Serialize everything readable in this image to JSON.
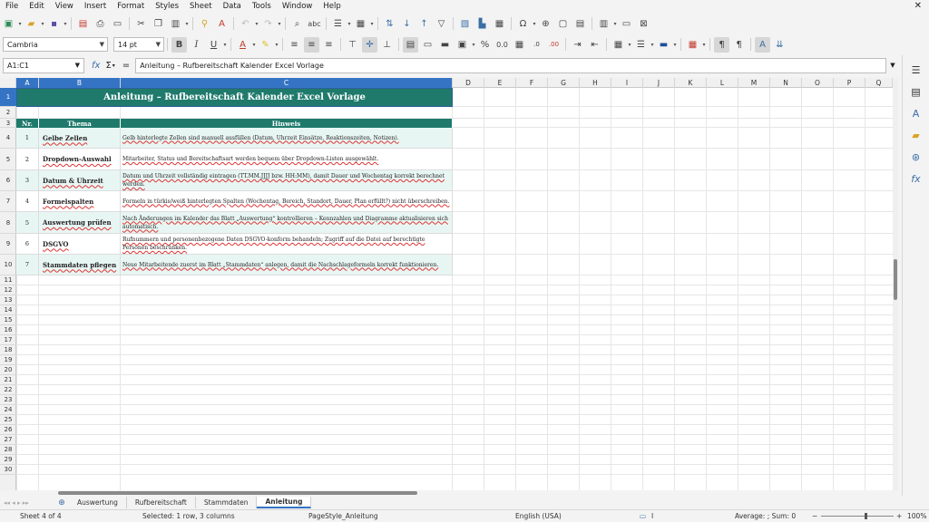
{
  "menubar": {
    "items": [
      "File",
      "Edit",
      "View",
      "Insert",
      "Format",
      "Styles",
      "Sheet",
      "Data",
      "Tools",
      "Window",
      "Help"
    ]
  },
  "format_bar": {
    "font_name": "Cambria",
    "font_size": "14 pt"
  },
  "formula_bar": {
    "name_box": "A1:C1",
    "sum_icon": "Σ",
    "equals": "=",
    "content": "Anleitung – Rufbereitschaft Kalender Excel Vorlage"
  },
  "columns": [
    "A",
    "B",
    "C",
    "D",
    "E",
    "F",
    "G",
    "H",
    "I",
    "J",
    "K",
    "L",
    "M",
    "N",
    "O",
    "P",
    "Q"
  ],
  "rows": [
    "1",
    "2",
    "3",
    "4",
    "5",
    "6",
    "7",
    "8",
    "9",
    "10",
    "11",
    "12",
    "13",
    "14",
    "15",
    "16",
    "17",
    "18",
    "19",
    "20",
    "21",
    "22",
    "23",
    "24",
    "25",
    "26",
    "27",
    "28",
    "29",
    "30"
  ],
  "sheet": {
    "title": "Anleitung – Rufbereitschaft Kalender Excel Vorlage",
    "headers": [
      "Nr.",
      "Thema",
      "Hinweis"
    ],
    "rows": [
      {
        "nr": "1",
        "thema": "Gelbe Zellen",
        "hinweis": "Gelb hinterlegte Zellen sind manuell ausfüllen (Datum, Uhrzeit Einsätze, Reaktionszeiten, Notizen)."
      },
      {
        "nr": "2",
        "thema": "Dropdown-Auswahl",
        "hinweis": "Mitarbeiter, Status und Bereitschaftsart werden bequem über Dropdown-Listen ausgewählt."
      },
      {
        "nr": "3",
        "thema": "Datum & Uhrzeit",
        "hinweis": "Datum und Uhrzeit vollständig eintragen (TT.MM.JJJJ bzw. HH:MM), damit Dauer und Wochentag korrekt berechnet werden."
      },
      {
        "nr": "4",
        "thema": "Formelspalten",
        "hinweis": "Formeln in türkis/weiß hinterlegten Spalten (Wochentag, Bereich, Standort, Dauer, Plan erfüllt?) nicht überschreiben."
      },
      {
        "nr": "5",
        "thema": "Auswertung prüfen",
        "hinweis": "Nach Änderungen im Kalender das Blatt „Auswertung“ kontrollieren – Kennzahlen und Diagramme aktualisieren sich automatisch."
      },
      {
        "nr": "6",
        "thema": "DSGVO",
        "hinweis": "Rufnummern und personenbezogene Daten DSGVO-konform behandeln; Zugriff auf die Datei auf berechtigte Personen beschränken."
      },
      {
        "nr": "7",
        "thema": "Stammdaten pflegen",
        "hinweis": "Neue Mitarbeitende zuerst im Blatt „Stammdaten“ anlegen, damit die Nachschlageformeln korrekt funktionieren."
      }
    ]
  },
  "tabs": {
    "items": [
      "Auswertung",
      "Rufbereitschaft",
      "Stammdaten",
      "Anleitung"
    ],
    "active": "Anleitung"
  },
  "status": {
    "sheet": "Sheet 4 of 4",
    "selection": "Selected: 1 row, 3 columns",
    "page_style": "PageStyle_Anleitung",
    "language": "English (USA)",
    "aggregate": "Average: ; Sum: 0",
    "zoom": "100%"
  },
  "colors": {
    "header_teal": "#1f7a6c",
    "row_tint": "#e8f6f3",
    "selection_blue": "#3574c4"
  }
}
